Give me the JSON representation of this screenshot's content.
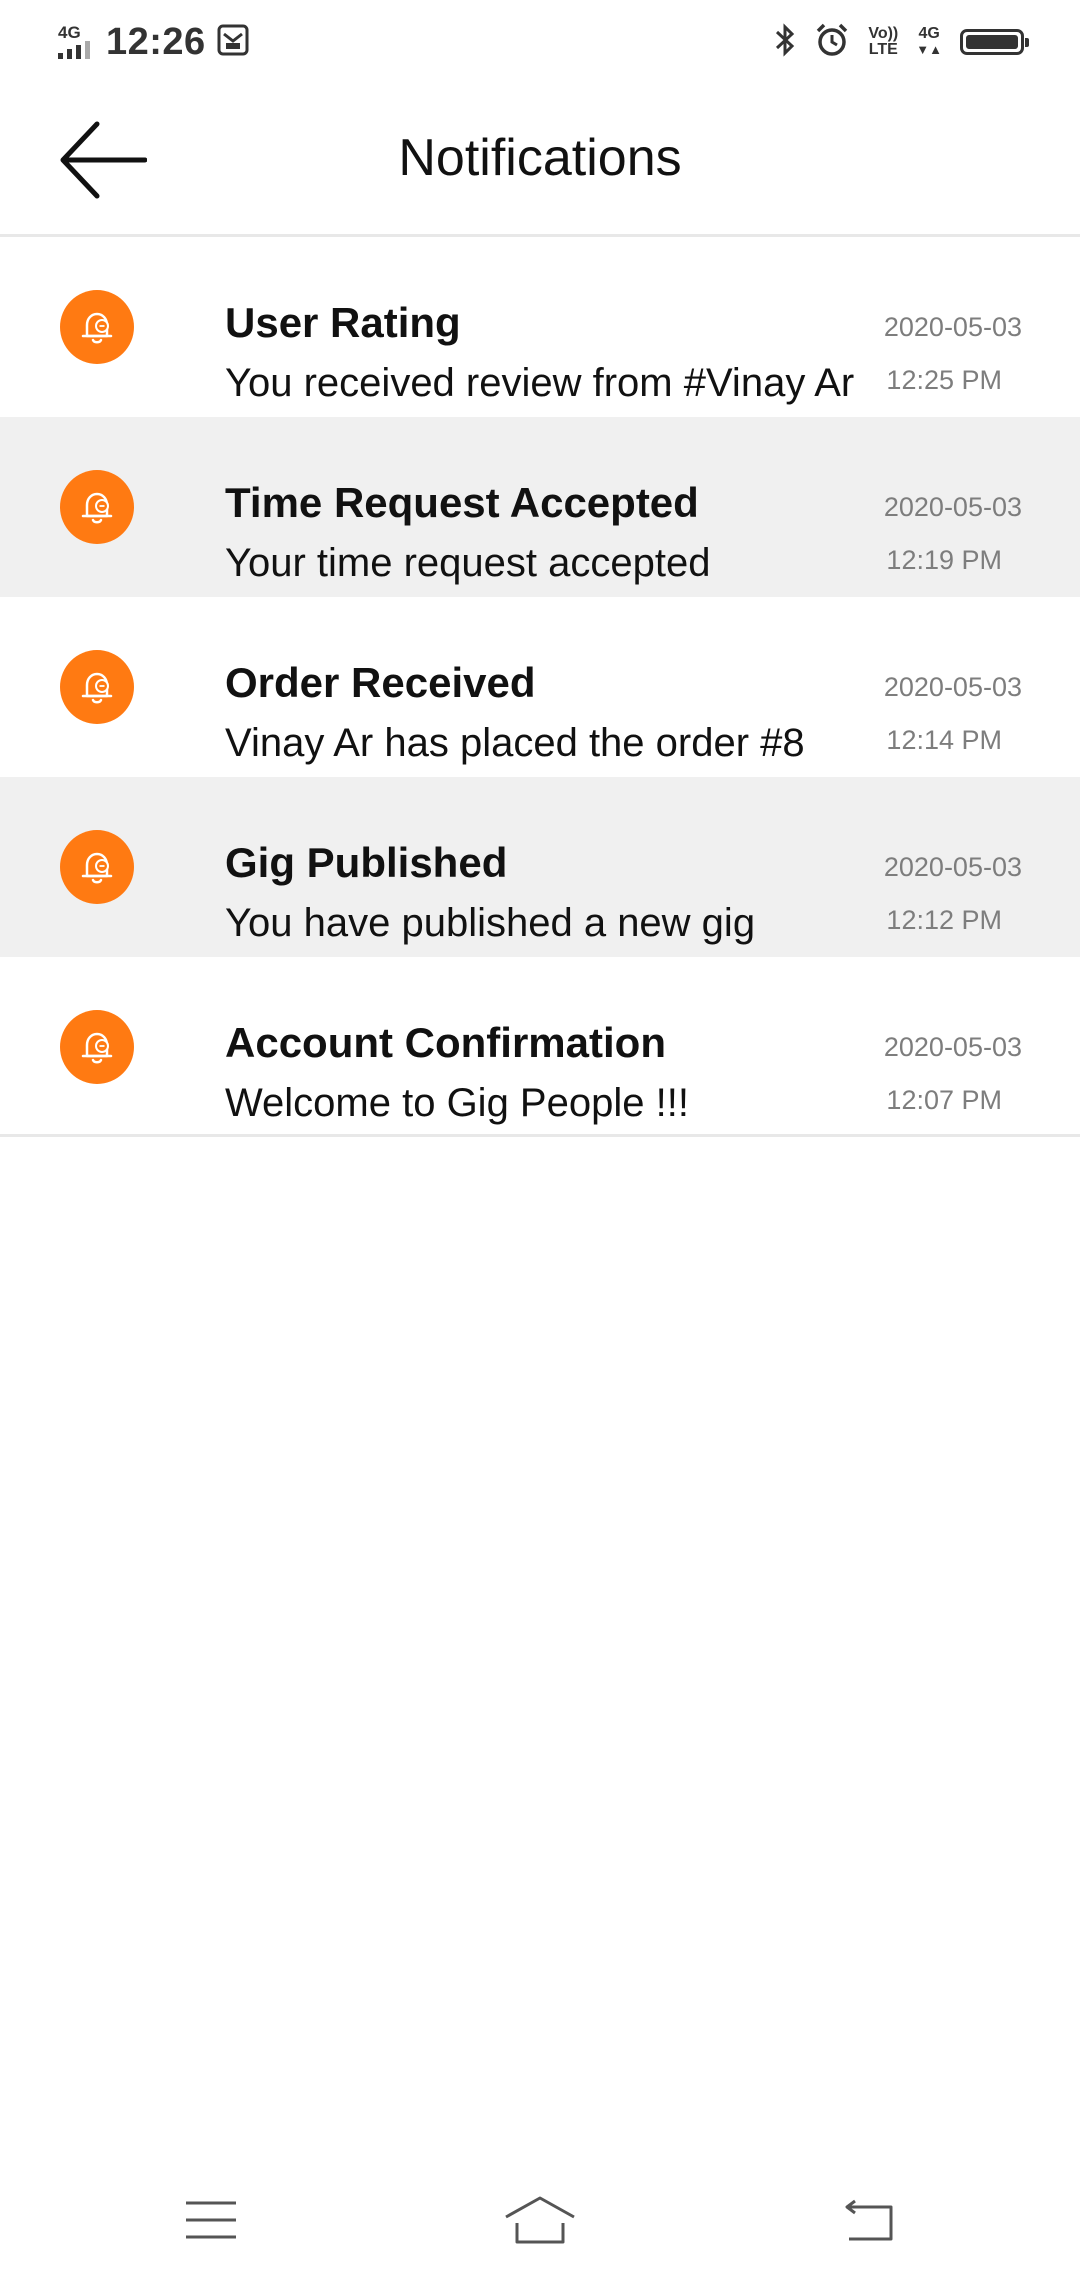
{
  "status_bar": {
    "network": "4G",
    "time": "12:26",
    "volte_top": "Vo))",
    "volte_bottom": "LTE",
    "network_right": "4G",
    "icons": [
      "signal-icon",
      "message-icon",
      "bluetooth-icon",
      "alarm-icon",
      "battery-icon"
    ]
  },
  "header": {
    "title": "Notifications",
    "back_icon": "arrow-left-icon"
  },
  "notifications": [
    {
      "title": "User Rating",
      "message": "You received review from #Vinay Ar",
      "date": "2020-05-03",
      "time": "12:25 PM",
      "shaded": false
    },
    {
      "title": "Time Request Accepted",
      "message": "Your time request accepted",
      "date": "2020-05-03",
      "time": "12:19 PM",
      "shaded": true
    },
    {
      "title": "Order Received",
      "message": "Vinay Ar has placed the order #8",
      "date": "2020-05-03",
      "time": "12:14 PM",
      "shaded": false
    },
    {
      "title": "Gig Published",
      "message": "You have published a new gig",
      "date": "2020-05-03",
      "time": "12:12 PM",
      "shaded": true
    },
    {
      "title": "Account Confirmation",
      "message": "Welcome to Gig People !!!",
      "date": "2020-05-03",
      "time": "12:07 PM",
      "shaded": false
    }
  ],
  "colors": {
    "accent": "#ff7a12",
    "shaded_row": "#f0f0f0",
    "muted_text": "#7d7d7d"
  },
  "nav": {
    "icons": [
      "menu-icon",
      "home-icon",
      "back-icon"
    ]
  }
}
